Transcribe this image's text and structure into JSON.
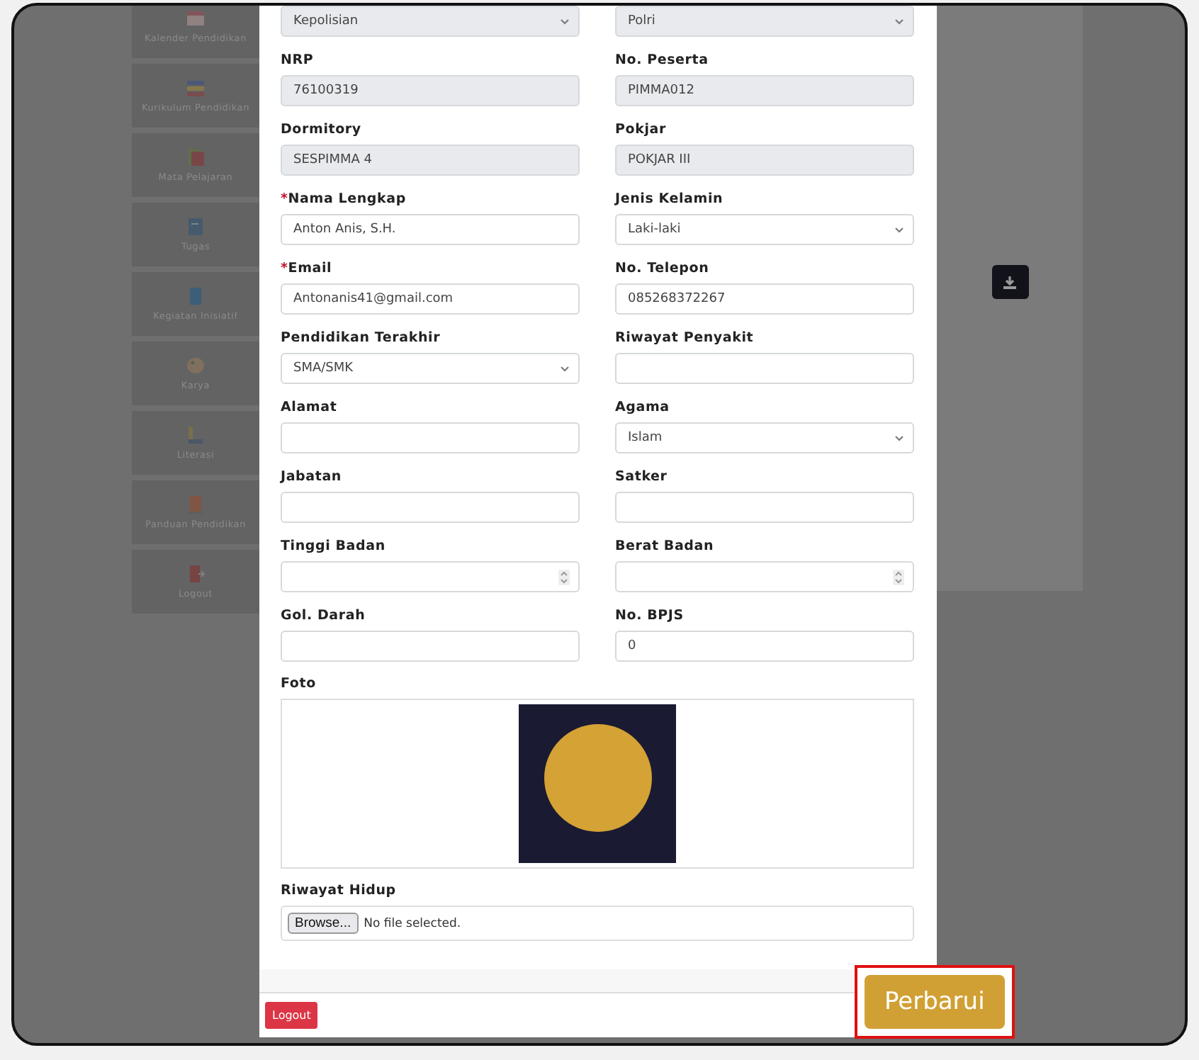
{
  "sidebar": {
    "items": [
      {
        "label": "Kalender Pendidikan"
      },
      {
        "label": "Kurikulum Pendidikan"
      },
      {
        "label": "Mata Pelajaran"
      },
      {
        "label": "Tugas"
      },
      {
        "label": "Kegiatan Inisiatif"
      },
      {
        "label": "Karya"
      },
      {
        "label": "Literasi"
      },
      {
        "label": "Panduan Pendidikan"
      },
      {
        "label": "Logout"
      }
    ]
  },
  "form": {
    "fields": [
      {
        "kind": "readonly-select",
        "value": "Kepolisian"
      },
      {
        "kind": "readonly-select",
        "value": "Polri"
      },
      {
        "label": "NRP",
        "kind": "readonly",
        "value": "76100319"
      },
      {
        "label": "No. Peserta",
        "kind": "readonly",
        "value": "PIMMA012"
      },
      {
        "label": "Dormitory",
        "kind": "readonly",
        "value": "SESPIMMA 4"
      },
      {
        "label": "Pokjar",
        "kind": "readonly",
        "value": "POKJAR III"
      },
      {
        "label": "Nama Lengkap",
        "mark": "*",
        "kind": "text",
        "value": "Anton Anis, S.H."
      },
      {
        "label": "Jenis Kelamin",
        "kind": "select",
        "value": "Laki-laki"
      },
      {
        "label": "Email",
        "mark": "*",
        "kind": "text",
        "value": "Antonanis41@gmail.com"
      },
      {
        "label": "No. Telepon",
        "kind": "text",
        "value": "085268372267"
      },
      {
        "label": "Pendidikan Terakhir",
        "kind": "select",
        "value": "SMA/SMK"
      },
      {
        "label": "Riwayat Penyakit",
        "kind": "text"
      },
      {
        "label": "Alamat",
        "kind": "text"
      },
      {
        "label": "Agama",
        "kind": "select",
        "value": "Islam"
      },
      {
        "label": "Jabatan",
        "kind": "text"
      },
      {
        "label": "Satker",
        "kind": "text"
      },
      {
        "label": "Tinggi Badan",
        "kind": "number"
      },
      {
        "label": "Berat Badan",
        "kind": "number"
      },
      {
        "label": "Gol. Darah",
        "kind": "text"
      },
      {
        "label": "No. BPJS",
        "kind": "text",
        "value": "0"
      }
    ],
    "photo": {
      "label": "Foto"
    },
    "cv": {
      "label": "Riwayat Hidup",
      "button": "Browse...",
      "status": "No file selected."
    }
  },
  "footer": {
    "logout": "Logout"
  },
  "update_button": {
    "label": "Perbarui",
    "highlighted": true
  }
}
